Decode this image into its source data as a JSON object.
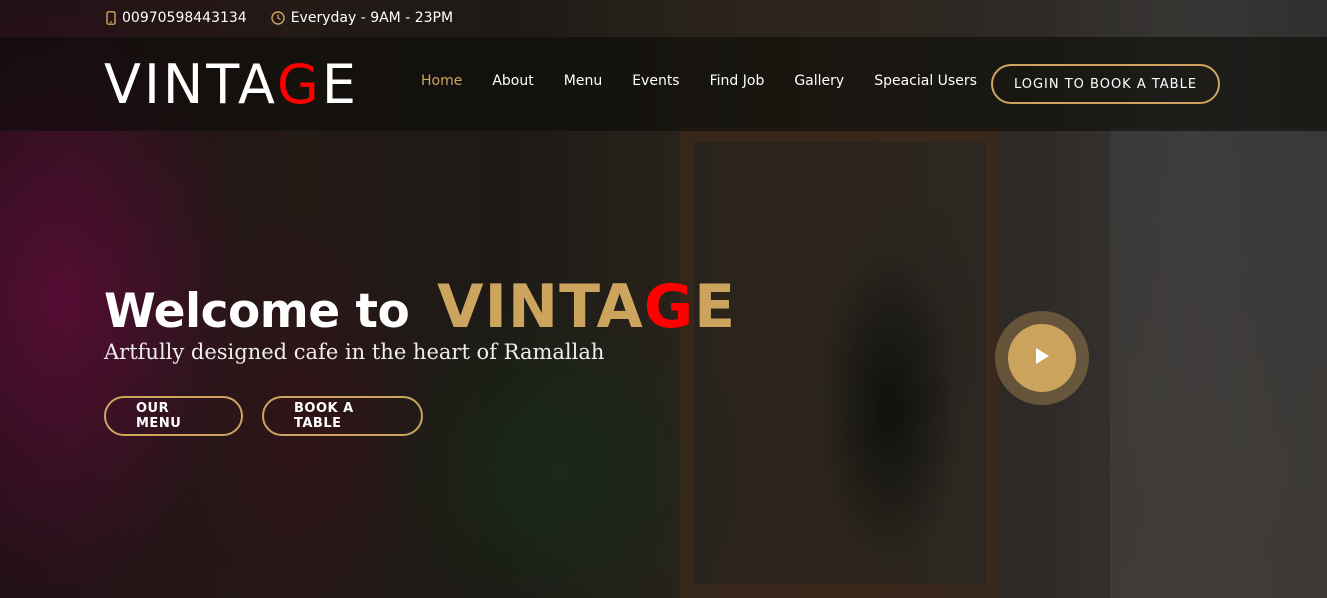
{
  "topbar": {
    "phone": "00970598443134",
    "phone_icon": "phone-icon",
    "hours": "Everyday - 9AM - 23PM",
    "hours_icon": "clock-icon"
  },
  "header": {
    "logo_main": "VINTA",
    "logo_accent": "G",
    "logo_end": "E",
    "nav": [
      {
        "label": "Home",
        "active": true
      },
      {
        "label": "About"
      },
      {
        "label": "Menu"
      },
      {
        "label": "Events"
      },
      {
        "label": "Find Job"
      },
      {
        "label": "Gallery"
      },
      {
        "label": "Speacial Users"
      }
    ],
    "login_button": "LOGIN TO BOOK A TABLE"
  },
  "hero": {
    "title_prefix": "Welcome to",
    "brand_main": "VINTA",
    "brand_accent": "G",
    "brand_end": "E",
    "subtitle": "Artfully designed cafe in the heart of Ramallah",
    "menu_button": "OUR MENU",
    "book_button": "BOOK A TABLE",
    "play_icon": "play-icon"
  },
  "colors": {
    "accent_gold": "#cda45e",
    "logo_red": "#ff0000",
    "header_bg": "#0c0b09"
  }
}
